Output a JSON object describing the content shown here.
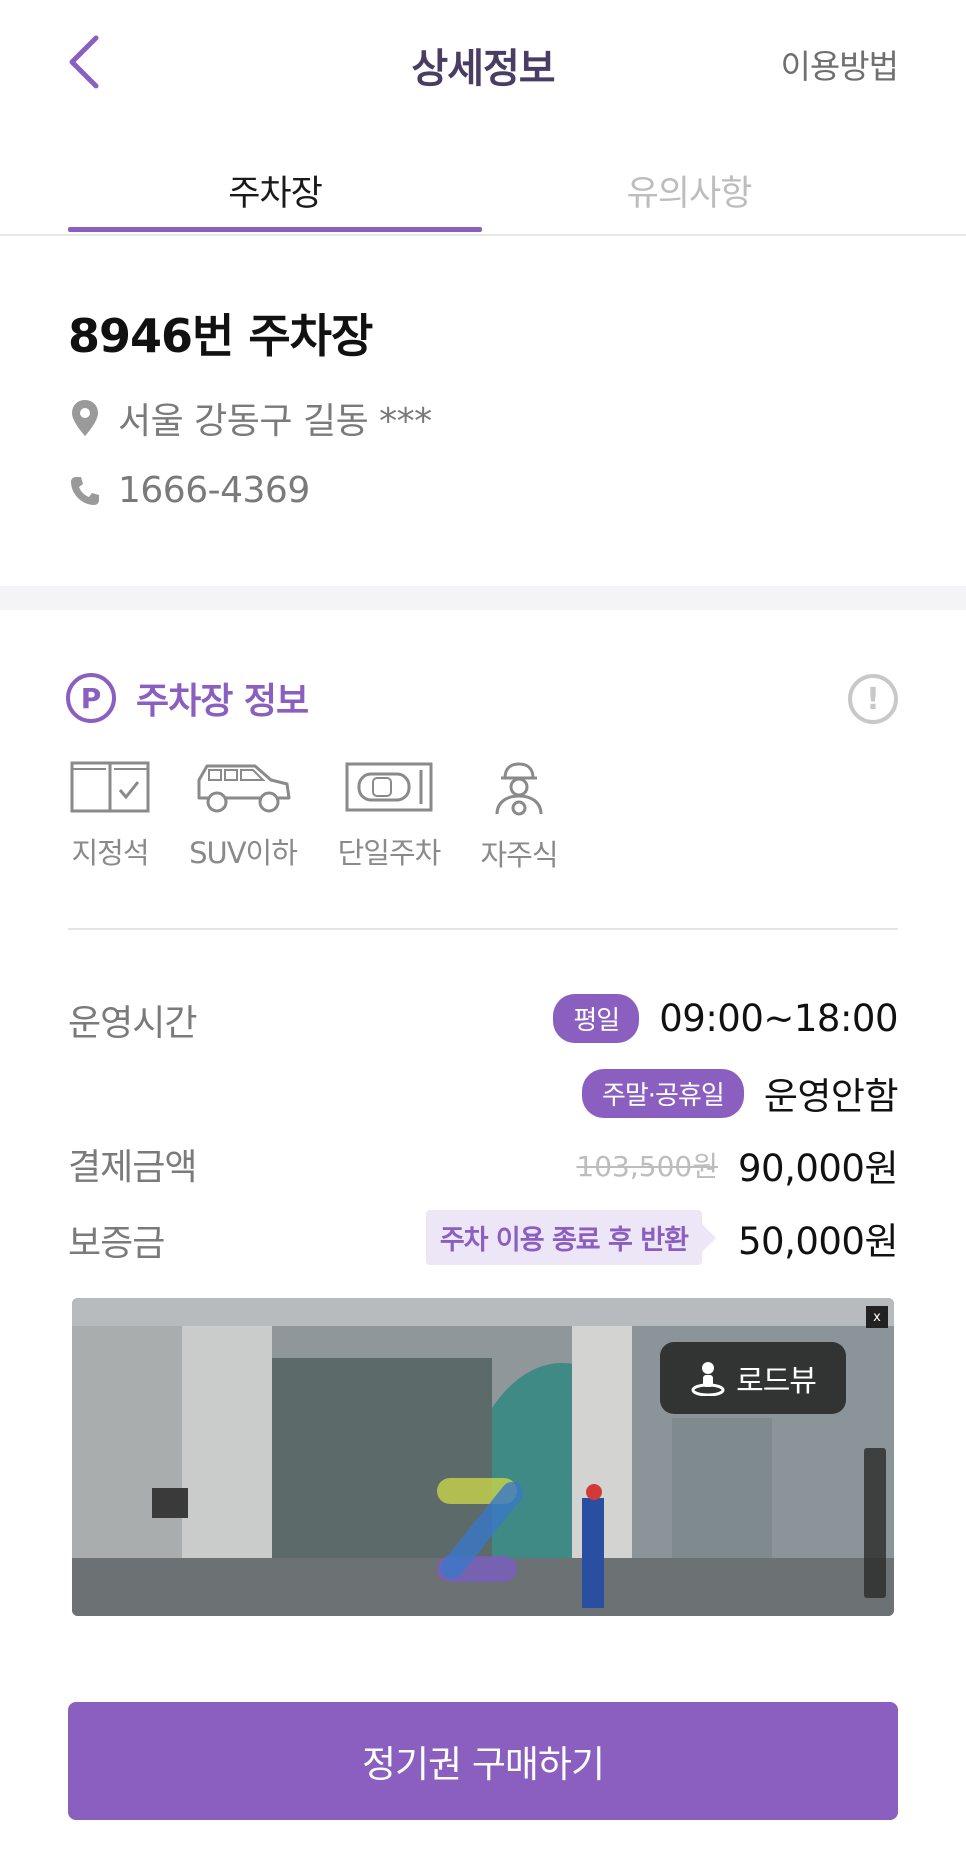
{
  "header": {
    "title": "상세정보",
    "guide_label": "이용방법",
    "back_icon": "chevron-left-icon"
  },
  "tabs": [
    {
      "label": "주차장",
      "active": true
    },
    {
      "label": "유의사항",
      "active": false
    }
  ],
  "lot": {
    "name": "8946번 주차장",
    "address": "서울 강동구 길동 ***",
    "phone": "1666-4369"
  },
  "parking_info": {
    "title": "주차장 정보",
    "badge_letter": "P",
    "alert_mark": "!",
    "features": [
      {
        "label": "지정석",
        "icon": "reserved-seat-icon"
      },
      {
        "label": "SUV이하",
        "icon": "suv-icon"
      },
      {
        "label": "단일주차",
        "icon": "single-parking-icon"
      },
      {
        "label": "자주식",
        "icon": "self-parking-driver-icon"
      }
    ]
  },
  "details": {
    "hours_label": "운영시간",
    "weekday_tag": "평일",
    "weekday_hours": "09:00~18:00",
    "weekend_tag": "주말·공휴일",
    "weekend_hours": "운영안함",
    "payment_label": "결제금액",
    "original_price": "103,500원",
    "price": "90,000원",
    "deposit_label": "보증금",
    "deposit_note": "주차 이용 종료 후 반환",
    "deposit": "50,000원"
  },
  "roadview": {
    "label": "로드뷰",
    "close_label": "x"
  },
  "cta": {
    "label": "정기권 구매하기"
  },
  "colors": {
    "accent": "#8a5fc0",
    "title": "#4a3d63",
    "muted": "#7a7a7a"
  }
}
